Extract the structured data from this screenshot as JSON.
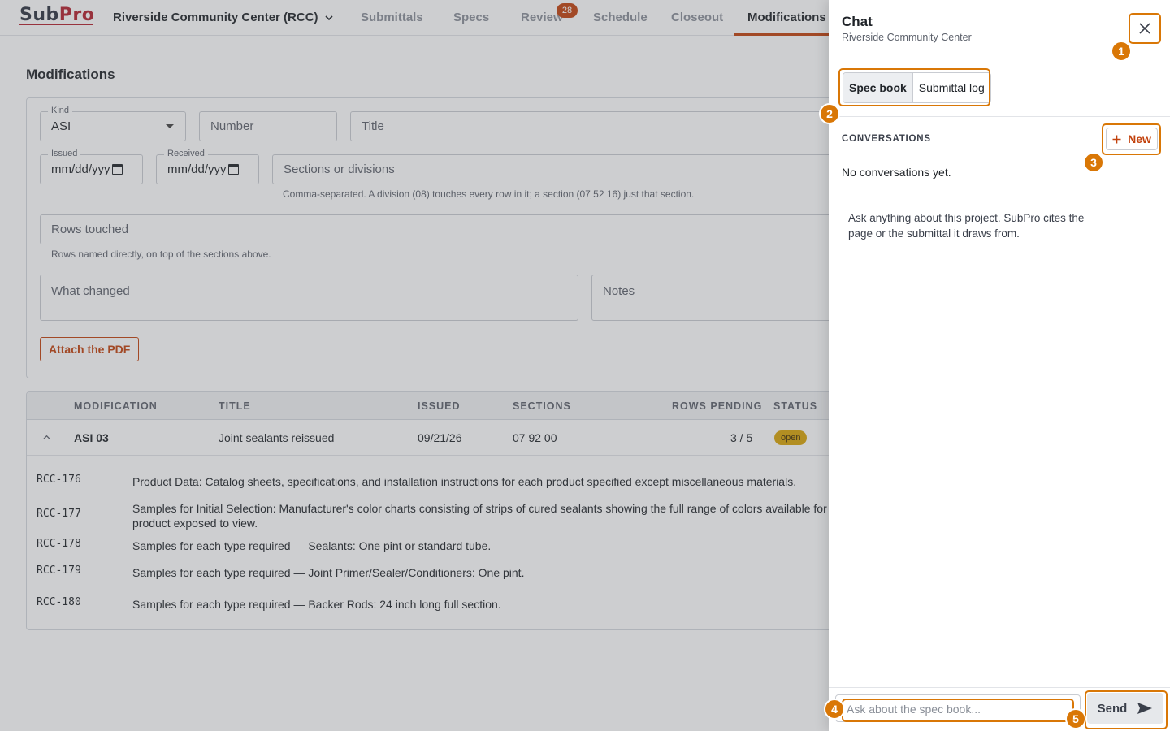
{
  "app": {
    "logo": {
      "sub": "Sub",
      "pro": "Pro"
    },
    "project": "Riverside Community Center (RCC)",
    "nav": [
      {
        "label": "Submittals"
      },
      {
        "label": "Specs"
      },
      {
        "label": "Review",
        "badge": "28"
      },
      {
        "label": "Schedule"
      },
      {
        "label": "Closeout"
      },
      {
        "label": "Modifications",
        "active": true
      }
    ]
  },
  "page": {
    "title": "Modifications",
    "form": {
      "kind": {
        "label": "Kind",
        "value": "ASI"
      },
      "number": {
        "placeholder": "Number"
      },
      "title": {
        "placeholder": "Title"
      },
      "issued": {
        "label": "Issued",
        "value": "mm/dd/yyy"
      },
      "received": {
        "label": "Received",
        "value": "mm/dd/yyy"
      },
      "sections": {
        "placeholder": "Sections or divisions",
        "help": "Comma-separated. A division (08) touches every row in it; a section (07 52 16) just that section."
      },
      "rows_touched": {
        "placeholder": "Rows touched",
        "help": "Rows named directly, on top of the sections above."
      },
      "what_changed": {
        "placeholder": "What changed"
      },
      "notes": {
        "placeholder": "Notes"
      },
      "attach_label": "Attach the PDF"
    },
    "table": {
      "headers": {
        "modification": "MODIFICATION",
        "title": "TITLE",
        "issued": "ISSUED",
        "sections": "SECTIONS",
        "rows_pending": "ROWS PENDING",
        "status": "STATUS"
      },
      "row": {
        "modification": "ASI 03",
        "title": "Joint sealants reissued",
        "issued": "09/21/26",
        "sections": "07 92 00",
        "rows_pending": "3 / 5",
        "status": "open"
      },
      "sub_rows": [
        {
          "code": "RCC-176",
          "text": "Product Data: Catalog sheets, specifications, and installation instructions for each product specified except miscellaneous materials."
        },
        {
          "code": "RCC-177",
          "text": "Samples for Initial Selection: Manufacturer's color charts consisting of strips of cured sealants showing the full range of colors available for each product exposed to view."
        },
        {
          "code": "RCC-178",
          "text": "Samples for each type required — Sealants: One pint or standard tube."
        },
        {
          "code": "RCC-179",
          "text": "Samples for each type required — Joint Primer/Sealer/Conditioners: One pint."
        },
        {
          "code": "RCC-180",
          "text": "Samples for each type required — Backer Rods: 24 inch long full section."
        }
      ]
    }
  },
  "chat": {
    "title": "Chat",
    "subtitle": "Riverside Community Center",
    "close_icon": "close-icon",
    "sources": [
      {
        "label": "Spec book",
        "active": true
      },
      {
        "label": "Submittal log",
        "active": false
      }
    ],
    "conversations_heading": "CONVERSATIONS",
    "new_label": "New",
    "empty_text": "No conversations yet.",
    "intro": "Ask anything about this project. SubPro cites the page or the submittal it draws from.",
    "input_placeholder": "Ask about the spec book...",
    "send_label": "Send"
  },
  "annotations": {
    "accent": "#d97706",
    "markers": [
      "1",
      "2",
      "3",
      "4",
      "5"
    ]
  }
}
